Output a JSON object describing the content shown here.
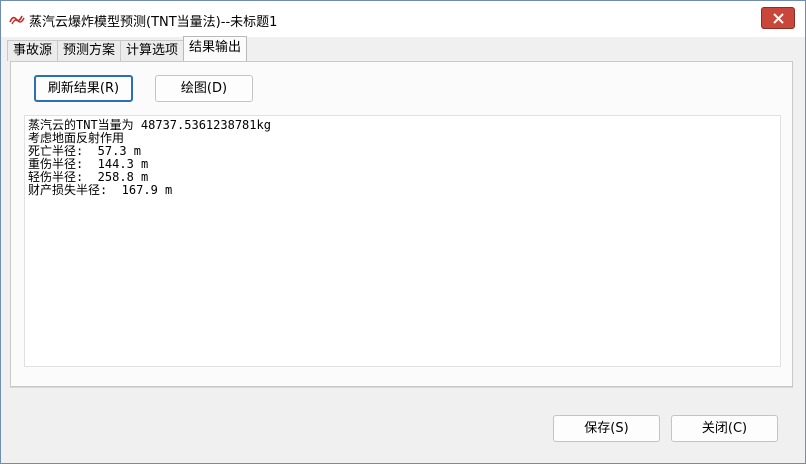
{
  "window": {
    "title": "蒸汽云爆炸模型预测(TNT当量法)--未标题1"
  },
  "tabs": [
    {
      "label": "事故源"
    },
    {
      "label": "预测方案"
    },
    {
      "label": "计算选项"
    },
    {
      "label": "结果输出"
    }
  ],
  "toolbar": {
    "refresh_label": "刷新结果(R)",
    "plot_label": "绘图(D)"
  },
  "results": {
    "lines": [
      "蒸汽云的TNT当量为 48737.5361238781kg",
      "考虑地面反射作用",
      "死亡半径:  57.3 m",
      "重伤半径:  144.3 m",
      "轻伤半径:  258.8 m",
      "财产损失半径:  167.9 m"
    ]
  },
  "footer": {
    "save_label": "保存(S)",
    "close_label": "关闭(C)"
  },
  "colors": {
    "close_button": "#c9473a",
    "focus_border": "#2b6fb8",
    "app_icon": "#c62828"
  }
}
